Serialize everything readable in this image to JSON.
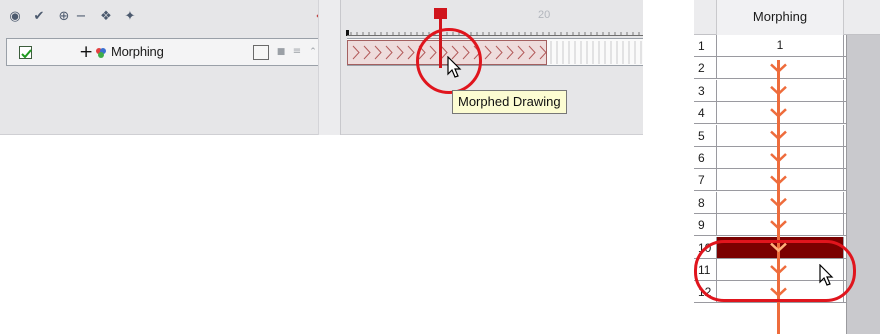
{
  "timeline": {
    "toolbar_icons": [
      "onion-skin-icon",
      "add-drawing-layer-icon",
      "add-layer-icon",
      "remove-layer-icon",
      "peg-icon",
      "effect-icon"
    ],
    "playhead_icon": "playhead-sync-icon",
    "ruler_frame_number": "20",
    "layer": {
      "name": "Morphing",
      "enabled": true
    },
    "tooltip": "Morphed Drawing"
  },
  "xsheet": {
    "column_header": "Morphing",
    "rows": [
      {
        "frame": "1",
        "value": "1"
      },
      {
        "frame": "2",
        "value": ""
      },
      {
        "frame": "3",
        "value": ""
      },
      {
        "frame": "4",
        "value": ""
      },
      {
        "frame": "5",
        "value": ""
      },
      {
        "frame": "6",
        "value": ""
      },
      {
        "frame": "7",
        "value": ""
      },
      {
        "frame": "8",
        "value": ""
      },
      {
        "frame": "9",
        "value": ""
      },
      {
        "frame": "10",
        "value": ""
      },
      {
        "frame": "11",
        "value": ""
      },
      {
        "frame": "12",
        "value": ""
      }
    ],
    "selected_frame": "10"
  },
  "colors": {
    "playhead": "#d0151c",
    "highlight_circle": "#e0151d",
    "morph_arrow": "#ee6c3c",
    "selected_cell": "#7b0000",
    "tooltip_bg": "#fcfcd2"
  }
}
